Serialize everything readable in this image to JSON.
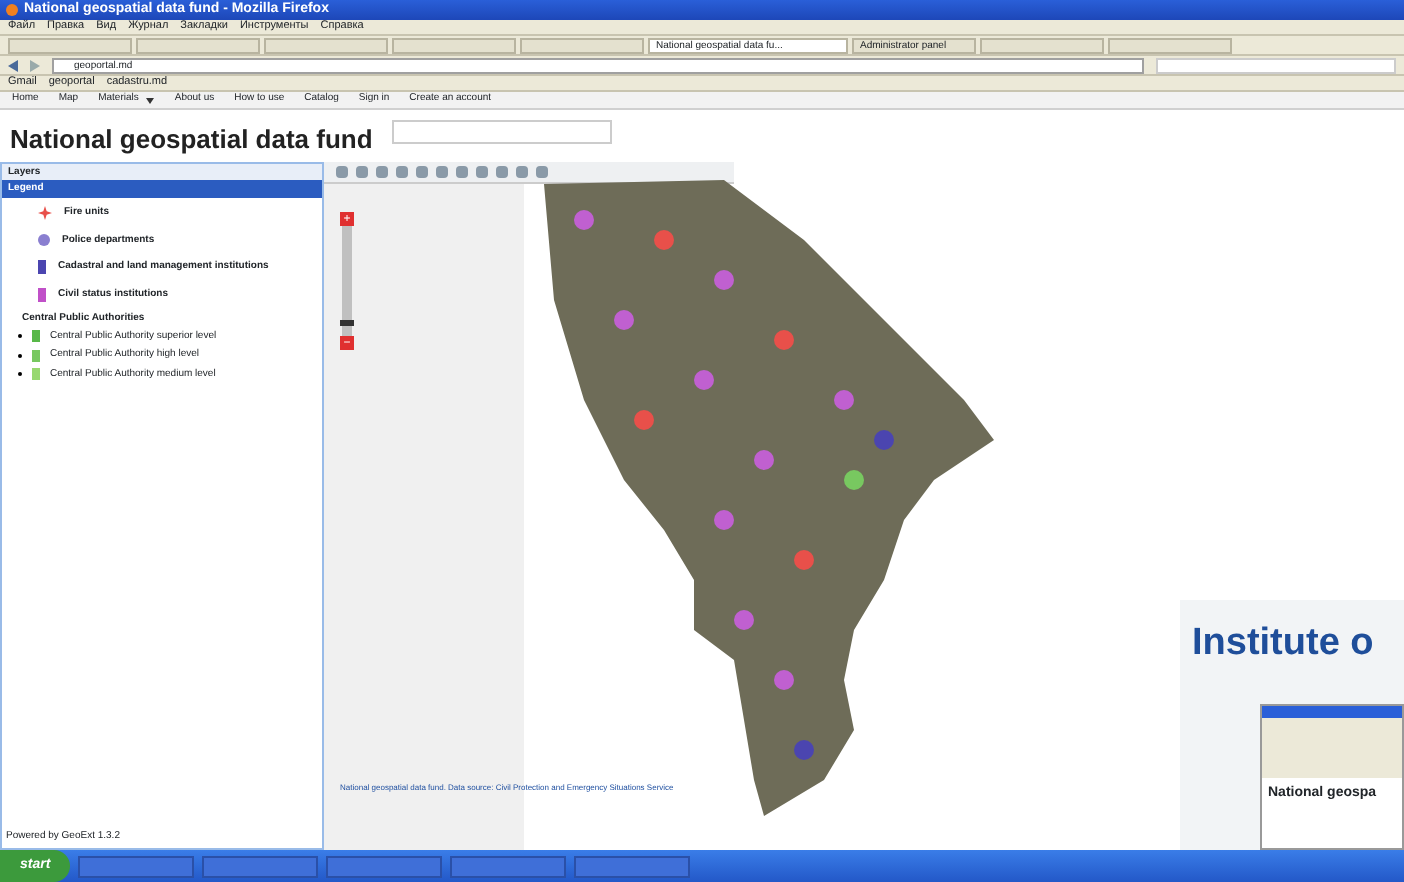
{
  "window": {
    "title": "National geospatial data fund - Mozilla Firefox"
  },
  "menu_bar": [
    "Файл",
    "Правка",
    "Вид",
    "Журнал",
    "Закладки",
    "Инструменты",
    "Справка"
  ],
  "tabs": [
    {
      "selected": false
    },
    {
      "selected": false
    },
    {
      "selected": false
    },
    {
      "selected": false
    },
    {
      "selected": false
    },
    {
      "label": "National geospatial data fu...",
      "selected": true
    },
    {
      "label": "Administrator panel",
      "selected": false
    },
    {
      "selected": false
    },
    {
      "selected": false
    }
  ],
  "address_bar": {
    "value": "geoportal.md"
  },
  "bookmarks": [
    "Gmail",
    "geoportal",
    "cadastru.md"
  ],
  "site_nav": [
    {
      "label": "Home",
      "dropdown": false
    },
    {
      "label": "Map",
      "dropdown": false
    },
    {
      "label": "Materials",
      "dropdown": true
    },
    {
      "label": "About us",
      "dropdown": false
    },
    {
      "label": "How to use",
      "dropdown": false
    },
    {
      "label": "Catalog",
      "dropdown": false
    },
    {
      "label": "Sign in",
      "dropdown": false
    },
    {
      "label": "Create an account",
      "dropdown": false
    }
  ],
  "page_title": "National geospatial data fund",
  "layers_panel": {
    "title": "Layers",
    "legend_title": "Legend",
    "items": [
      {
        "label": "Fire units",
        "kind": "star",
        "color": "#e8504a"
      },
      {
        "label": "Police departments",
        "kind": "circle",
        "color": "#8a7fd0"
      },
      {
        "label": "Cadastral and land management institutions",
        "kind": "square",
        "color": "#4b45b0"
      },
      {
        "label": "Civil status institutions",
        "kind": "square",
        "color": "#c050c8"
      }
    ],
    "group_title": "Central Public Authorities",
    "group_items": [
      {
        "label": "Central Public Authority superior level",
        "color": "#58b848"
      },
      {
        "label": "Central Public Authority high level",
        "color": "#78c860"
      },
      {
        "label": "Central Public Authority medium level",
        "color": "#98d870"
      }
    ],
    "footer": "Powered by GeoExt 1.3.2"
  },
  "map": {
    "zoom_in": "+",
    "zoom_out": "−",
    "zoom_slider": {
      "level": 0.1
    },
    "attribution": "National geospatial data fund. Data source: Civil Protection and Emergency Situations Service"
  },
  "overlay": {
    "heading": "Institute o",
    "thumbnail_title": "National geospa"
  },
  "taskbar": {
    "start": "start"
  }
}
